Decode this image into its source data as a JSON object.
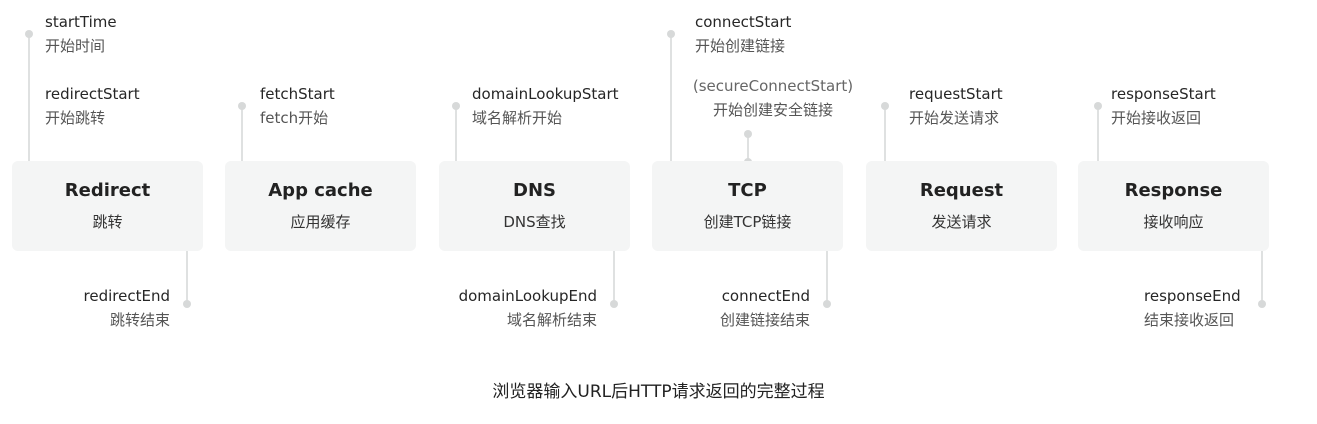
{
  "caption": "浏览器输入URL后HTTP请求返回的完整过程",
  "stages": [
    {
      "title": "Redirect",
      "subtitle": "跳转"
    },
    {
      "title": "App cache",
      "subtitle": "应用缓存"
    },
    {
      "title": "DNS",
      "subtitle": "DNS查找"
    },
    {
      "title": "TCP",
      "subtitle": "创建TCP链接"
    },
    {
      "title": "Request",
      "subtitle": "发送请求"
    },
    {
      "title": "Response",
      "subtitle": "接收响应"
    }
  ],
  "markers": {
    "startTime": {
      "name": "startTime",
      "desc": "开始时间"
    },
    "redirectStart": {
      "name": "redirectStart",
      "desc": "开始跳转"
    },
    "redirectEnd": {
      "name": "redirectEnd",
      "desc": "跳转结束"
    },
    "fetchStart": {
      "name": "fetchStart",
      "desc": "fetch开始"
    },
    "domainLookupStart": {
      "name": "domainLookupStart",
      "desc": "域名解析开始"
    },
    "domainLookupEnd": {
      "name": "domainLookupEnd",
      "desc": "域名解析结束"
    },
    "connectStart": {
      "name": "connectStart",
      "desc": "开始创建链接"
    },
    "secureConnectStart": {
      "name": "(secureConnectStart)",
      "desc": "开始创建安全链接"
    },
    "connectEnd": {
      "name": "connectEnd",
      "desc": "创建链接结束"
    },
    "requestStart": {
      "name": "requestStart",
      "desc": "开始发送请求"
    },
    "responseStart": {
      "name": "responseStart",
      "desc": "开始接收返回"
    },
    "responseEnd": {
      "name": "responseEnd",
      "desc": "结束接收返回"
    }
  }
}
